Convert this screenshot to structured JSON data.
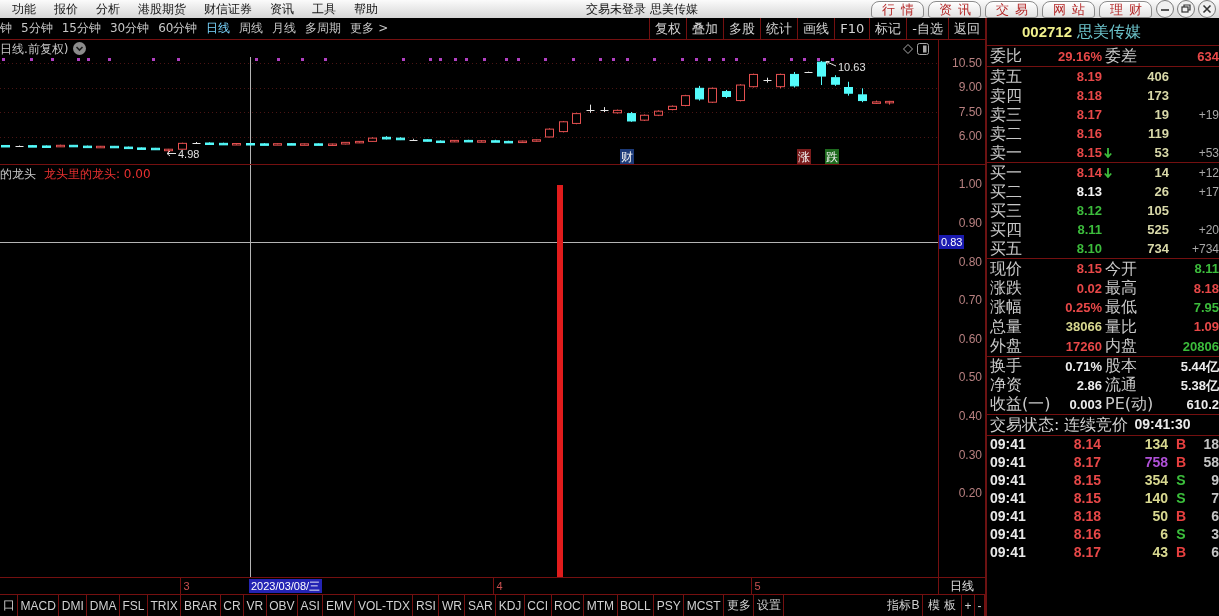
{
  "menu_bar": {
    "menus": [
      "功能",
      "报价",
      "分析",
      "港股期货",
      "财信证券",
      "资讯",
      "工具",
      "帮助"
    ],
    "title": "交易未登录 思美传媒",
    "tabs": [
      "行情",
      "资讯",
      "交易",
      "网站",
      "理财"
    ]
  },
  "period_bar": {
    "periods": [
      {
        "label": "钟",
        "selected": false
      },
      {
        "label": "5分钟",
        "selected": false
      },
      {
        "label": "15分钟",
        "selected": false
      },
      {
        "label": "30分钟",
        "selected": false
      },
      {
        "label": "60分钟",
        "selected": false
      },
      {
        "label": "日线",
        "selected": true
      },
      {
        "label": "周线",
        "selected": false
      },
      {
        "label": "月线",
        "selected": false
      },
      {
        "label": "多周期",
        "selected": false
      },
      {
        "label": "更多 >",
        "selected": false
      }
    ],
    "tools": [
      "复权",
      "叠加",
      "多股",
      "统计",
      "画线",
      "F10",
      "标记",
      "-自选",
      "返回"
    ]
  },
  "price_chart": {
    "title": "日线.前复权)",
    "y_ticks": [
      "10.50",
      "9.00",
      "7.50",
      "6.00"
    ],
    "high_label": "10.63",
    "low_label": "4.98",
    "markers": [
      {
        "label": "财",
        "color": "#1c3a78"
      },
      {
        "label": "涨",
        "color": "#7a1c1c"
      },
      {
        "label": "跌",
        "color": "#1e6a1e"
      }
    ]
  },
  "indicator_chart": {
    "name": "的龙头",
    "reading": "龙头里的龙头: 0.00",
    "y_ticks": [
      "1.00",
      "0.90",
      "0.80",
      "0.70",
      "0.60",
      "0.50",
      "0.40",
      "0.30",
      "0.20"
    ],
    "cursor_value": "0.83"
  },
  "date_axis": {
    "months": [
      "3",
      "4",
      "5"
    ],
    "cursor_date": "2023/03/08/三",
    "period": "日线"
  },
  "indicator_tabs": {
    "tabs": [
      "口",
      "MACD",
      "DMI",
      "DMA",
      "FSL",
      "TRIX",
      "BRAR",
      "CR",
      "VR",
      "OBV",
      "ASI",
      "EMV",
      "VOL-TDX",
      "RSI",
      "WR",
      "SAR",
      "KDJ",
      "CCI",
      "ROC",
      "MTM",
      "BOLL",
      "PSY",
      "MCST",
      "更多",
      "设置"
    ],
    "buttons": [
      "指标B",
      "模板",
      "+",
      "-"
    ]
  },
  "quote": {
    "code": "002712",
    "name": "思美传媒",
    "order_ratio": [
      {
        "label": "委比",
        "value": "29.16%",
        "color": "#e84848"
      },
      {
        "label": "委差",
        "value": "634",
        "color": "#e84848"
      }
    ],
    "asks": [
      {
        "label": "卖五",
        "price": "8.19",
        "color": "#e84848",
        "down_arrow": false,
        "volume": "406"
      },
      {
        "label": "卖四",
        "price": "8.18",
        "color": "#e84848",
        "down_arrow": false,
        "volume": "173"
      },
      {
        "label": "卖三",
        "price": "8.17",
        "color": "#e84848",
        "down_arrow": false,
        "volume": "19",
        "change": "+19"
      },
      {
        "label": "卖二",
        "price": "8.16",
        "color": "#e84848",
        "down_arrow": false,
        "volume": "119"
      },
      {
        "label": "卖一",
        "price": "8.15",
        "color": "#e84848",
        "down_arrow": true,
        "volume": "53",
        "change": "+53"
      }
    ],
    "bids": [
      {
        "label": "买一",
        "price": "8.14",
        "color": "#e84848",
        "down_arrow": true,
        "volume": "14",
        "change": "+12"
      },
      {
        "label": "买二",
        "price": "8.13",
        "color": "#f4f4f4",
        "down_arrow": false,
        "volume": "26",
        "change": "+17"
      },
      {
        "label": "买三",
        "price": "8.12",
        "color": "#3cbc3c",
        "down_arrow": false,
        "volume": "105"
      },
      {
        "label": "买四",
        "price": "8.11",
        "color": "#3cbc3c",
        "down_arrow": false,
        "volume": "525",
        "change": "+20"
      },
      {
        "label": "买五",
        "price": "8.10",
        "color": "#3cbc3c",
        "down_arrow": false,
        "volume": "734",
        "change": "+734"
      }
    ],
    "stats": [
      {
        "label": "现价",
        "value": "8.15",
        "color": "#e84848"
      },
      {
        "label": "今开",
        "value": "8.11",
        "color": "#3cbc3c"
      },
      {
        "label": "涨跌",
        "value": "0.02",
        "color": "#e84848"
      },
      {
        "label": "最高",
        "value": "8.18",
        "color": "#e84848"
      },
      {
        "label": "涨幅",
        "value": "0.25%",
        "color": "#e84848"
      },
      {
        "label": "最低",
        "value": "7.95",
        "color": "#3cbc3c"
      },
      {
        "label": "总量",
        "value": "38066",
        "color": "#d8d890"
      },
      {
        "label": "量比",
        "value": "1.09",
        "color": "#e84848"
      },
      {
        "label": "外盘",
        "value": "17260",
        "color": "#e84848"
      },
      {
        "label": "内盘",
        "value": "20806",
        "color": "#3cbc3c"
      }
    ],
    "fundamentals": [
      {
        "label": "换手",
        "value": "0.71%"
      },
      {
        "label": "股本",
        "value": "5.44亿"
      },
      {
        "label": "净资",
        "value": "2.86"
      },
      {
        "label": "流通",
        "value": "5.38亿"
      },
      {
        "label": "收益(一)",
        "value": "0.003"
      },
      {
        "label": "PE(动)",
        "value": "610.2"
      }
    ],
    "status": {
      "label": "交易状态: 连续竞价",
      "time": "09:41:30"
    },
    "ticks": [
      {
        "time": "09:41",
        "price": "8.14",
        "volume": "134",
        "large": false,
        "side": "B",
        "color": "#e84040",
        "count": "18"
      },
      {
        "time": "09:41",
        "price": "8.17",
        "volume": "758",
        "large": true,
        "side": "B",
        "color": "#e84040",
        "count": "58"
      },
      {
        "time": "09:41",
        "price": "8.15",
        "volume": "354",
        "large": false,
        "side": "S",
        "color": "#3cc03c",
        "count": "9"
      },
      {
        "time": "09:41",
        "price": "8.15",
        "volume": "140",
        "large": false,
        "side": "S",
        "color": "#3cc03c",
        "count": "7"
      },
      {
        "time": "09:41",
        "price": "8.18",
        "volume": "50",
        "large": false,
        "side": "B",
        "color": "#e84040",
        "count": "6"
      },
      {
        "time": "09:41",
        "price": "8.16",
        "volume": "6",
        "large": false,
        "side": "S",
        "color": "#3cc03c",
        "count": "3"
      },
      {
        "time": "09:41",
        "price": "8.17",
        "volume": "43",
        "large": false,
        "side": "B",
        "color": "#e84040",
        "count": "6"
      }
    ]
  }
}
